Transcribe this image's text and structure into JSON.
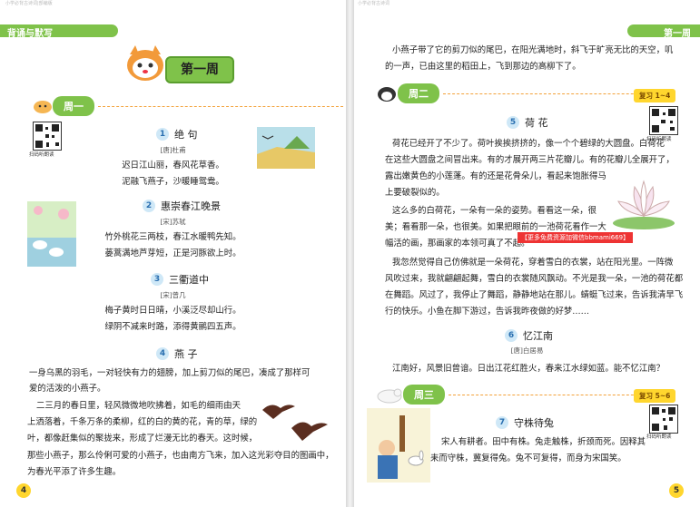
{
  "top_strip_left": "小学必背古诗词|部编版",
  "top_strip_right": "小学必背古诗词",
  "left": {
    "header": "背诵与默写",
    "week_banner": "第一周",
    "week_label": "周一",
    "qr_caption": "扫码听朗读",
    "page_number": "4",
    "poems": [
      {
        "num": "1",
        "title": "绝  句",
        "author": "[唐]杜甫",
        "lines": [
          "迟日江山丽，春风花草香。",
          "泥融飞燕子，沙暖睡鸳鸯。"
        ]
      },
      {
        "num": "2",
        "title": "惠崇春江晚景",
        "author": "[宋]苏轼",
        "lines": [
          "竹外桃花三两枝，春江水暖鸭先知。",
          "蒌蒿满地芦芽短，正是河豚欲上时。"
        ]
      },
      {
        "num": "3",
        "title": "三衢道中",
        "author": "[宋]曾几",
        "lines": [
          "梅子黄时日日晴，小溪泛尽却山行。",
          "绿阴不减来时路，添得黄鹂四五声。"
        ]
      }
    ],
    "essay": {
      "num": "4",
      "title": "燕  子",
      "lines": [
        "一身乌黑的羽毛，一对轻快有力的翅膀，加上剪刀似的尾巴，凑成了那样可",
        "爱的活泼的小燕子。",
        "二三月的春日里，轻风微微地吹拂着，如毛的细雨由天",
        "上洒落着，千条万条的柔柳，红的白的黄的花，青的草，绿的",
        "叶，都像赶集似的聚拢来，形成了烂漫无比的春天。这时候，",
        "那些小燕子，那么伶俐可爱的小燕子，也由南方飞来，加入这光彩夺目的图画中，",
        "为春光平添了许多生趣。"
      ]
    }
  },
  "right": {
    "header": "第一周",
    "page_number": "5",
    "intro_lines": [
      "小燕子带了它的剪刀似的尾巴，在阳光满地时，斜飞于旷亮无比的天空，叽",
      "的一声，已由这里的稻田上，飞到那边的高柳下了。"
    ],
    "week2": {
      "label": "周二",
      "review": "复习 1~4",
      "qr_caption": "扫码听朗读",
      "essay": {
        "num": "5",
        "title": "荷  花",
        "lines": [
          "荷花已经开了不少了。荷叶挨挨挤挤的，像一个个碧绿的大圆盘。白荷花",
          "在这些大圆盘之间冒出来。有的才展开两三片花瓣儿。有的花瓣儿全展开了，",
          "露出嫩黄色的小莲蓬。有的还是花骨朵儿，看起来饱胀得马",
          "上要破裂似的。",
          "这么多的白荷花，一朵有一朵的姿势。看看这一朵，很",
          "美；看看那一朵，也很美。如果把眼前的一池荷花看作一大",
          "幅活的画，那画家的本领可真了不起。",
          "我忽然觉得自己仿佛就是一朵荷花，穿着雪白的衣裳，站在阳光里。一阵微",
          "风吹过来，我就翩翩起舞，雪白的衣裳随风飘动。不光是我一朵，一池的荷花都",
          "在舞蹈。风过了，我停止了舞蹈，静静地站在那儿。蜻蜓飞过来，告诉我清早飞",
          "行的快乐。小鱼在脚下游过，告诉我昨夜做的好梦……"
        ]
      },
      "watermark": "【更多免费资源加微信bbmami669】",
      "poem": {
        "num": "6",
        "title": "忆江南",
        "author": "[唐]白居易",
        "lines": [
          "江南好，风景旧曾谙。日出江花红胜火，春来江水绿如蓝。能不忆江南？"
        ]
      }
    },
    "week3": {
      "label": "周三",
      "review": "复习 5~6",
      "qr_caption": "扫码听朗读",
      "essay": {
        "num": "7",
        "title": "守株待兔",
        "lines": [
          "宋人有耕者。田中有株。兔走触株，折颈而死。因释其",
          "耒而守株，冀复得兔。兔不可复得，而身为宋国笑。"
        ]
      }
    }
  },
  "colors": {
    "green": "#7fc24a",
    "yellow": "#ffd62e",
    "orange": "#f3a23a",
    "blue": "#2a6fb0"
  }
}
